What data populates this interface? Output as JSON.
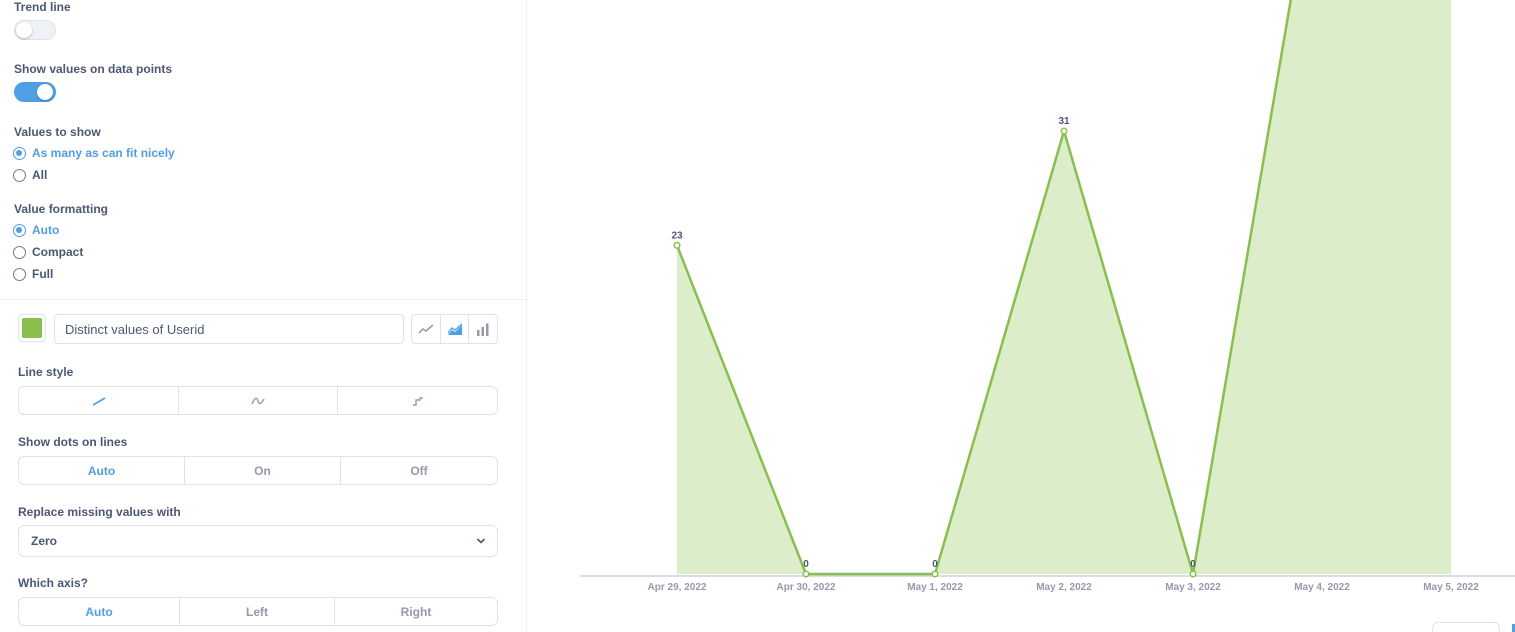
{
  "settings": {
    "trend_line": {
      "label": "Trend line",
      "on": false
    },
    "show_values": {
      "label": "Show values on data points",
      "on": true
    },
    "values_to_show": {
      "label": "Values to show",
      "options": [
        "As many as can fit nicely",
        "All"
      ],
      "selected": 0
    },
    "value_formatting": {
      "label": "Value formatting",
      "options": [
        "Auto",
        "Compact",
        "Full"
      ],
      "selected": 0
    }
  },
  "series": {
    "color": "#88BF4D",
    "name": "Distinct values of Userid",
    "display_types": [
      "line-chart-icon",
      "area-chart-icon",
      "bar-chart-icon"
    ],
    "selected_display": 1,
    "line_style": {
      "label": "Line style",
      "options": [
        "line-straight-icon",
        "line-curved-icon",
        "line-step-icon"
      ],
      "selected": 0
    },
    "show_dots": {
      "label": "Show dots on lines",
      "options": [
        "Auto",
        "On",
        "Off"
      ],
      "selected": 0
    },
    "replace_missing": {
      "label": "Replace missing values with",
      "value": "Zero"
    },
    "which_axis": {
      "label": "Which axis?",
      "options": [
        "Auto",
        "Left",
        "Right"
      ],
      "selected": 0
    }
  },
  "colors": {
    "accent": "#509EE3",
    "series": "#88BF4D",
    "area_fill": "#DCEDCA"
  },
  "chart_data": {
    "type": "area",
    "categories": [
      "Apr 29, 2022",
      "Apr 30, 2022",
      "May 1, 2022",
      "May 2, 2022",
      "May 3, 2022",
      "May 4, 2022",
      "May 5, 2022"
    ],
    "series": [
      {
        "values": [
          23,
          0,
          0,
          31,
          0,
          53,
          53
        ],
        "labels": [
          "23",
          "0",
          "0",
          "31",
          "0",
          "",
          ""
        ]
      }
    ],
    "title": "",
    "xlabel": "",
    "ylabel": "",
    "ylim": [
      0,
      45
    ],
    "grid": false,
    "show_values": true
  }
}
